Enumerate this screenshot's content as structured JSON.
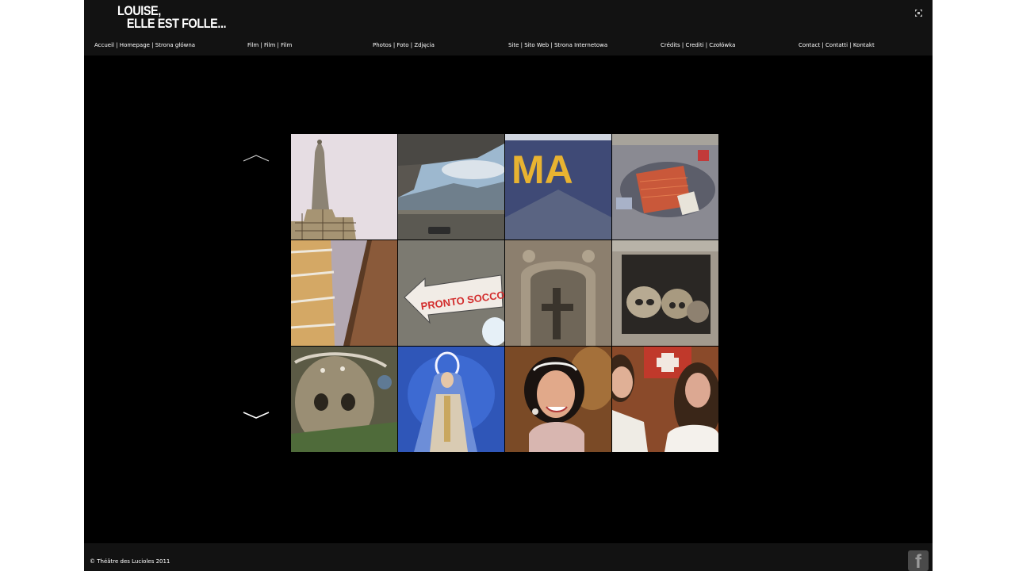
{
  "header": {
    "logo_line1": "Louise,",
    "logo_line2": "elle est folle..."
  },
  "nav": [
    {
      "label": "Accueil | Homepage | Strona główna"
    },
    {
      "label": "Film | Film | Film"
    },
    {
      "label": "Photos | Foto | Zdjęcia"
    },
    {
      "label": "Site | Sito Web | Strona Internetowa"
    },
    {
      "label": "Crédits | Crediti | Czołówka"
    },
    {
      "label": "Contact | Contatti | Kontakt"
    }
  ],
  "gallery": {
    "photos": [
      {
        "subject": "statue-tower"
      },
      {
        "subject": "overpass-mountain"
      },
      {
        "subject": "ma-sign"
      },
      {
        "subject": "street-rubbish"
      },
      {
        "subject": "building-balconies"
      },
      {
        "subject": "pronto-soccorso-sign",
        "caption": "PRONTO SOCCORSO"
      },
      {
        "subject": "stone-cross-niche"
      },
      {
        "subject": "skulls-shelf"
      },
      {
        "subject": "crowned-skull"
      },
      {
        "subject": "madonna-statue"
      },
      {
        "subject": "smiling-woman"
      },
      {
        "subject": "laughing-women"
      }
    ],
    "ma_text": "MA"
  },
  "footer": {
    "copyright": "© Théâtre des Lucioles 2011",
    "facebook_glyph": "f"
  },
  "colors": {
    "page_bg": "#000000",
    "header_bg": "#121212",
    "text": "#ffffff"
  }
}
